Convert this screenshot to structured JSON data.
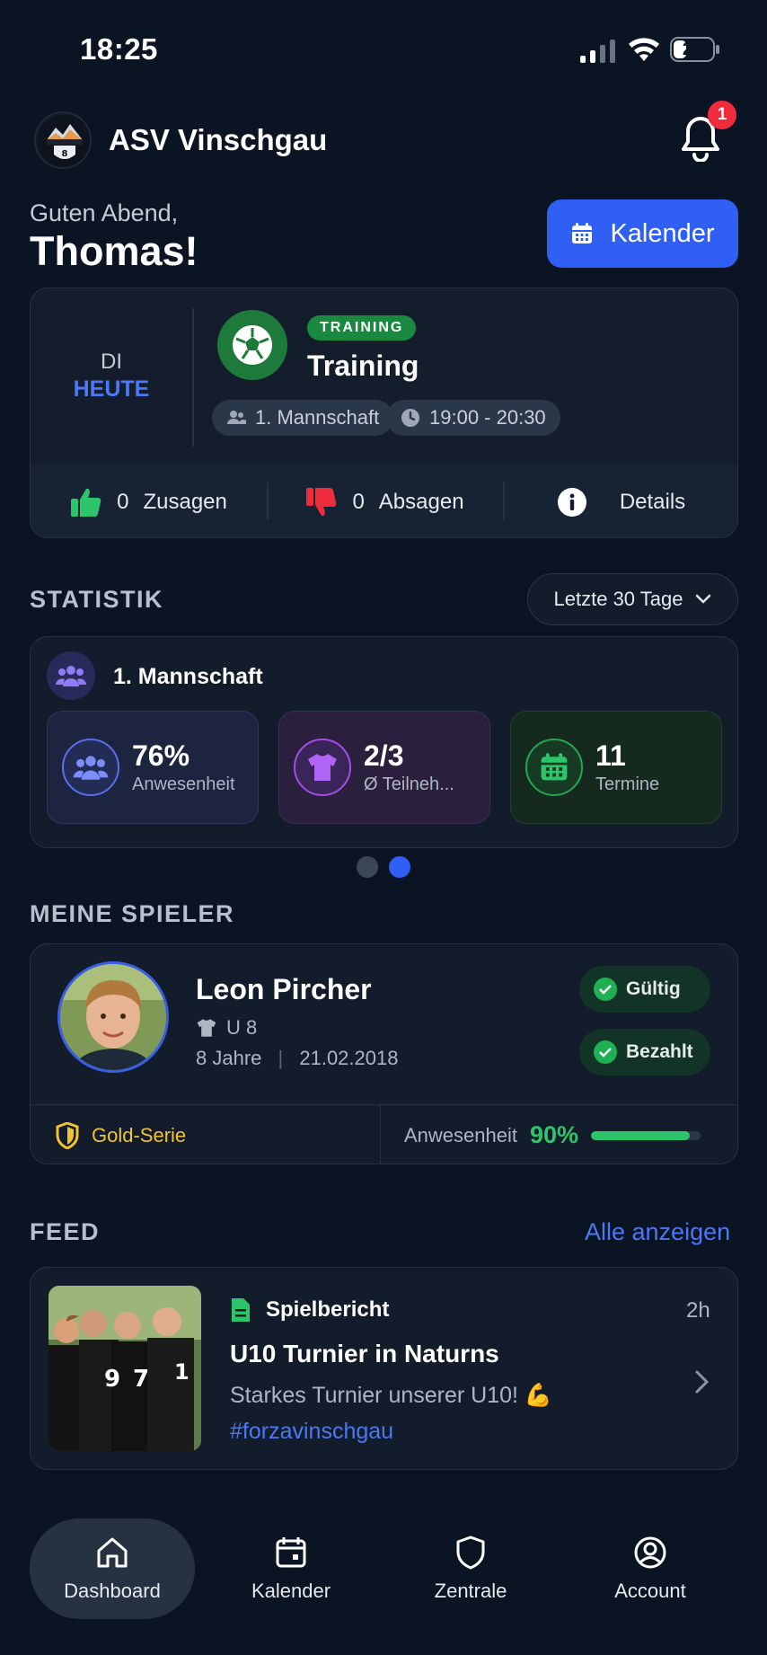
{
  "status_bar": {
    "time": "18:25",
    "battery": "27"
  },
  "header": {
    "club_name": "ASV Vinschgau",
    "notification_count": "1"
  },
  "greeting": {
    "line1": "Guten Abend,",
    "name": "Thomas!"
  },
  "calendar_button": {
    "label": "Kalender"
  },
  "event": {
    "weekday": "DI",
    "day_label": "HEUTE",
    "type_badge": "TRAINING",
    "title": "Training",
    "team": "1. Mannschaft",
    "time": "19:00 - 20:30",
    "accept_count": "0",
    "accept_label": "Zusagen",
    "decline_count": "0",
    "decline_label": "Absagen",
    "details_label": "Details"
  },
  "stats": {
    "section_title": "STATISTIK",
    "range": "Letzte 30 Tage",
    "team": "1. Mannschaft",
    "tiles": [
      {
        "value": "76%",
        "label": "Anwesenheit",
        "icon": "users-icon"
      },
      {
        "value": "2/3",
        "label": "Ø Teilneh...",
        "icon": "shirt-icon"
      },
      {
        "value": "11",
        "label": "Termine",
        "icon": "calendar-icon"
      }
    ],
    "pages": 2,
    "active_page": 2
  },
  "players": {
    "section_title": "MEINE SPIELER",
    "name": "Leon Pircher",
    "team": "U 8",
    "age": "8 Jahre",
    "separator": "|",
    "birthdate": "21.02.2018",
    "status_valid": "Gültig",
    "status_paid": "Bezahlt",
    "series": "Gold-Serie",
    "attendance_label": "Anwesenheit",
    "attendance_value": "90%",
    "attendance_fraction": 0.9
  },
  "feed": {
    "section_title": "FEED",
    "see_all": "Alle anzeigen",
    "item": {
      "type": "Spielbericht",
      "time": "2h",
      "title": "U10 Turnier in Naturns",
      "text": "Starkes Turnier unserer U10! 💪",
      "hashtag": "#forzavinschgau"
    }
  },
  "nav": {
    "items": [
      {
        "label": "Dashboard",
        "icon": "home-icon",
        "active": true
      },
      {
        "label": "Kalender",
        "icon": "calendar-icon",
        "active": false
      },
      {
        "label": "Zentrale",
        "icon": "shield-icon",
        "active": false
      },
      {
        "label": "Account",
        "icon": "user-circle-icon",
        "active": false
      }
    ]
  },
  "colors": {
    "accent": "#2f5ff3",
    "success": "#2cc56a",
    "danger": "#ef2b3c",
    "gold": "#f1c232",
    "background": "#0b1422"
  }
}
